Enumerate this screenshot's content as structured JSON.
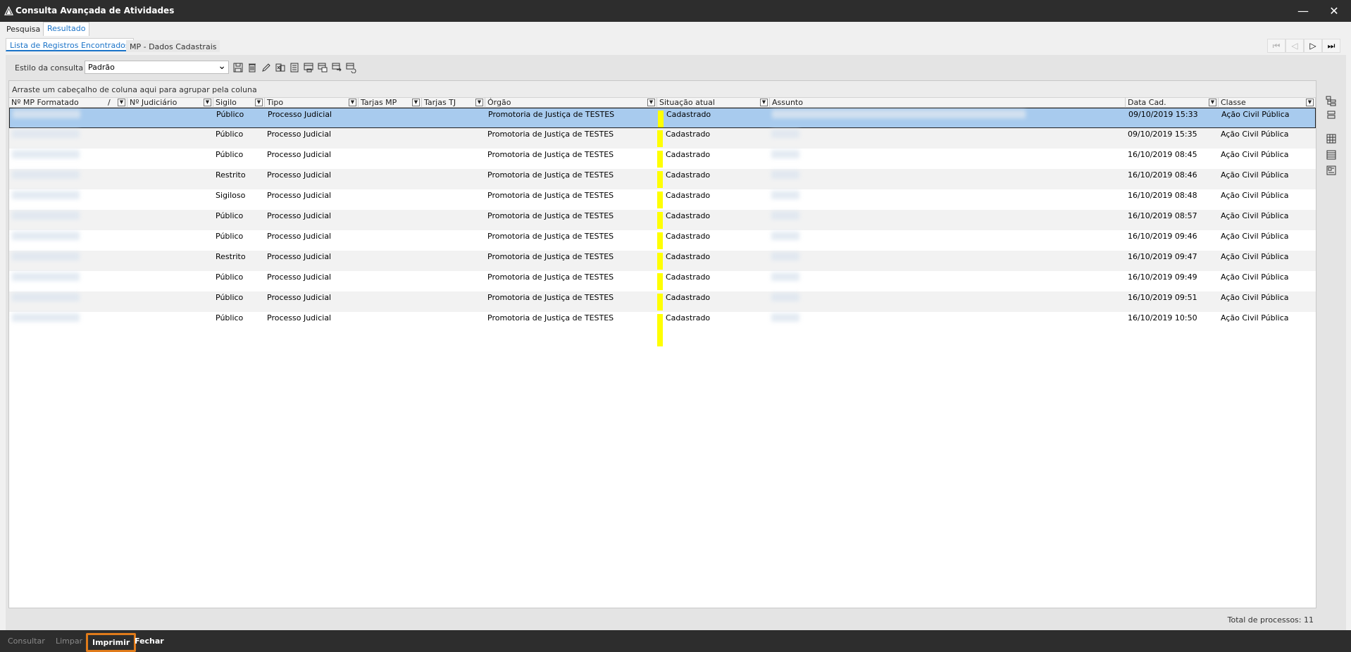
{
  "window": {
    "title": "Consulta Avançada de Atividades",
    "minimize_glyph": "—",
    "close_glyph": "✕"
  },
  "top_tabs": [
    {
      "label": "Pesquisa",
      "active": false
    },
    {
      "label": "Resultado",
      "active": true
    }
  ],
  "sub_tabs": [
    {
      "label": "Lista de Registros Encontrados",
      "active": true
    },
    {
      "label": "MP - Dados Cadastrais",
      "active": false
    }
  ],
  "nav": {
    "first": "⏮",
    "prev": "◁",
    "next": "▷",
    "last": "⏭"
  },
  "toolbar": {
    "style_label": "Estilo da consulta",
    "style_value": "Padrão",
    "icons": [
      "save-icon",
      "delete-icon",
      "edit-icon",
      "export-icon",
      "document-icon",
      "layout-icon",
      "layout-add-icon",
      "layout-swap-icon"
    ]
  },
  "grid": {
    "group_hint": "Arraste um cabeçalho de coluna aqui para agrupar pela coluna",
    "columns": [
      {
        "label": "Nº MP Formatado",
        "sort": "/"
      },
      {
        "label": "Nº Judiciário"
      },
      {
        "label": "Sigilo"
      },
      {
        "label": "Tipo"
      },
      {
        "label": "Tarjas MP"
      },
      {
        "label": "Tarjas TJ"
      },
      {
        "label": "Órgão"
      },
      {
        "label": "Situação atual"
      },
      {
        "label": "Assunto"
      },
      {
        "label": "Data Cad."
      },
      {
        "label": "Classe"
      }
    ],
    "rows": [
      {
        "sigilo": "Público",
        "tipo": "Processo Judicial",
        "orgao": "Promotoria de Justiça de TESTES",
        "situacao": "Cadastrado",
        "data": "09/10/2019 15:33",
        "classe": "Ação Civil Pública",
        "selected": true
      },
      {
        "sigilo": "Público",
        "tipo": "Processo Judicial",
        "orgao": "Promotoria de Justiça de TESTES",
        "situacao": "Cadastrado",
        "data": "09/10/2019 15:35",
        "classe": "Ação Civil Pública"
      },
      {
        "sigilo": "Público",
        "tipo": "Processo Judicial",
        "orgao": "Promotoria de Justiça de TESTES",
        "situacao": "Cadastrado",
        "data": "16/10/2019 08:45",
        "classe": "Ação Civil Pública"
      },
      {
        "sigilo": "Restrito",
        "tipo": "Processo Judicial",
        "orgao": "Promotoria de Justiça de TESTES",
        "situacao": "Cadastrado",
        "data": "16/10/2019 08:46",
        "classe": "Ação Civil Pública"
      },
      {
        "sigilo": "Sigiloso",
        "tipo": "Processo Judicial",
        "orgao": "Promotoria de Justiça de TESTES",
        "situacao": "Cadastrado",
        "data": "16/10/2019 08:48",
        "classe": "Ação Civil Pública"
      },
      {
        "sigilo": "Público",
        "tipo": "Processo Judicial",
        "orgao": "Promotoria de Justiça de TESTES",
        "situacao": "Cadastrado",
        "data": "16/10/2019 08:57",
        "classe": "Ação Civil Pública"
      },
      {
        "sigilo": "Público",
        "tipo": "Processo Judicial",
        "orgao": "Promotoria de Justiça de TESTES",
        "situacao": "Cadastrado",
        "data": "16/10/2019 09:46",
        "classe": "Ação Civil Pública"
      },
      {
        "sigilo": "Restrito",
        "tipo": "Processo Judicial",
        "orgao": "Promotoria de Justiça de TESTES",
        "situacao": "Cadastrado",
        "data": "16/10/2019 09:47",
        "classe": "Ação Civil Pública"
      },
      {
        "sigilo": "Público",
        "tipo": "Processo Judicial",
        "orgao": "Promotoria de Justiça de TESTES",
        "situacao": "Cadastrado",
        "data": "16/10/2019 09:49",
        "classe": "Ação Civil Pública"
      },
      {
        "sigilo": "Público",
        "tipo": "Processo Judicial",
        "orgao": "Promotoria de Justiça de TESTES",
        "situacao": "Cadastrado",
        "data": "16/10/2019 09:51",
        "classe": "Ação Civil Pública"
      },
      {
        "sigilo": "Público",
        "tipo": "Processo Judicial",
        "orgao": "Promotoria de Justiça de TESTES",
        "situacao": "Cadastrado",
        "data": "16/10/2019 10:50",
        "classe": "Ação Civil Pública"
      }
    ]
  },
  "side_icons": [
    "tree-expand-icon",
    "tree-collapse-icon",
    "table-view-icon",
    "list-view-icon",
    "card-view-icon"
  ],
  "status": {
    "total": "Total de processos: 11"
  },
  "bottom_buttons": [
    {
      "label": "Consultar",
      "state": "disabled"
    },
    {
      "label": "Limpar",
      "state": "disabled"
    },
    {
      "label": "Imprimir",
      "state": "focused"
    },
    {
      "label": "Fechar",
      "state": "normal"
    }
  ],
  "colors": {
    "selection": "#a8cbee",
    "status_marker": "#ffff00",
    "focus_ring": "#e07b1a",
    "accent": "#1a73c8"
  }
}
